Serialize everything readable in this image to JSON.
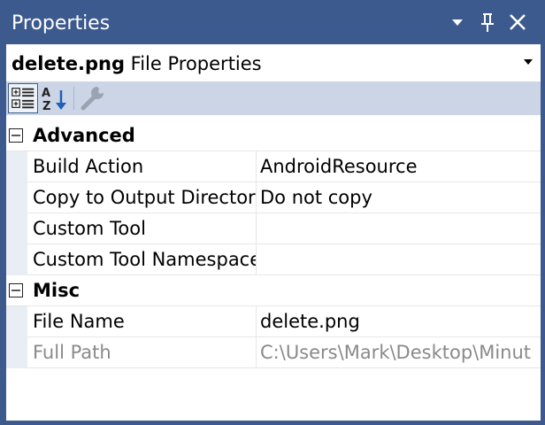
{
  "window": {
    "title": "Properties",
    "accent_color": "#3d5a8e",
    "buttons": [
      "dropdown-icon",
      "pin-icon",
      "close-icon"
    ]
  },
  "object_selector": {
    "name": "delete.png",
    "type": " File Properties"
  },
  "toolbar": {
    "tools": [
      "categorized-icon",
      "alphabetical-icon",
      "property-pages-icon"
    ]
  },
  "categories": [
    {
      "label": "Advanced",
      "properties": [
        {
          "name": "Build Action",
          "value": "AndroidResource"
        },
        {
          "name": "Copy to Output Directory",
          "value": "Do not copy"
        },
        {
          "name": "Custom Tool",
          "value": ""
        },
        {
          "name": "Custom Tool Namespace",
          "value": ""
        }
      ]
    },
    {
      "label": "Misc",
      "properties": [
        {
          "name": "File Name",
          "value": "delete.png"
        },
        {
          "name": "Full Path",
          "value": "C:\\Users\\Mark\\Desktop\\Minut"
        }
      ]
    }
  ]
}
